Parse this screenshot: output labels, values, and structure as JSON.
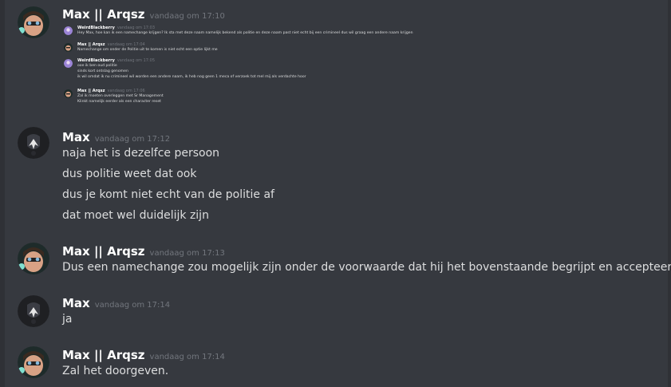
{
  "messages": [
    {
      "author": "Max || Arqsz",
      "timestamp": "vandaag om 17:10",
      "lines": []
    },
    {
      "author": "Max",
      "timestamp": "vandaag om 17:12",
      "lines": [
        "naja het is dezelfce persoon",
        "dus politie weet dat ook",
        "dus je komt niet echt van de politie af",
        "dat moet wel duidelijk zijn"
      ]
    },
    {
      "author": "Max || Arqsz",
      "timestamp": "vandaag om 17:13",
      "lines": [
        "Dus een namechange zou mogelijk zijn onder de voorwaarde dat hij het bovenstaande begrijpt en accepteert?"
      ]
    },
    {
      "author": "Max",
      "timestamp": "vandaag om 17:14",
      "lines": [
        "ja"
      ]
    },
    {
      "author": "Max || Arqsz",
      "timestamp": "vandaag om 17:14",
      "lines": [
        "Zal het doorgeven."
      ]
    }
  ],
  "embedded": [
    {
      "author": "WeirdBlackberry",
      "timestamp": "vandaag om 17:03",
      "lines": [
        "Hey Max, hoe kan ik een namechange krijgen? Ik sta met deze naam namelijk bekend als politie en deze naam past niet echt bij een crimineel dus wil graag een andere naam krijgen"
      ]
    },
    {
      "author": "Max || Arqsz",
      "timestamp": "vandaag om 17:04",
      "lines": [
        "Namechange om onder de Politie uit te komen is niet echt een optie lijkt me"
      ]
    },
    {
      "author": "WeirdBlackberry",
      "timestamp": "vandaag om 17:05",
      "lines": [
        "ooe ik ben oud politie",
        "sinds kort ontslag genomen",
        "ik wil omdat ik nu crimineel wil worden een andere naam, ik heb nog geen 1 meca of verzoek tot mel mij als verdachte hoor"
      ]
    },
    {
      "author": "Max || Arqsz",
      "timestamp": "vandaag om 17:06",
      "lines": [
        "Zal ik moeten overleggen met Sr Management",
        "Klinkt namelijk eerder als een character reset"
      ]
    }
  ],
  "colors": {
    "background": "#36393f",
    "text": "#dcddde",
    "author": "#ffffff",
    "timestamp": "#72767d"
  },
  "icons": {
    "avatar_arqsz": "photo-avatar",
    "avatar_max": "dark-logo-avatar",
    "avatar_weird": "colorful-avatar"
  }
}
